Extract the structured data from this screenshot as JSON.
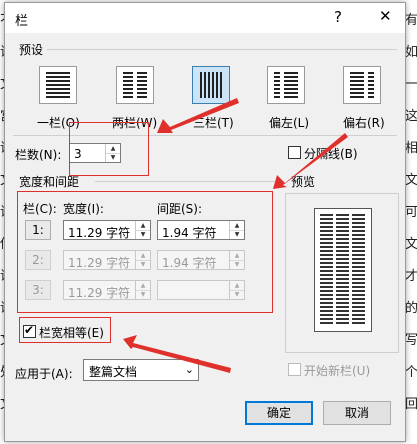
{
  "background_text": {
    "left": [
      "不",
      "诗",
      "文",
      "宫",
      "诗",
      "文",
      "诗",
      "你",
      "诗",
      "诗",
      "文",
      "处",
      "文"
    ],
    "right": [
      "有",
      "如",
      "一",
      "这",
      "相",
      "文",
      "可",
      "文",
      "才",
      "的",
      "写",
      "个",
      "回"
    ]
  },
  "dialog": {
    "title": "栏",
    "help": "?",
    "close": "✕"
  },
  "presets": {
    "group_label": "预设",
    "items": [
      {
        "label": "一栏(O)",
        "icon": "one-column-icon"
      },
      {
        "label": "两栏(W)",
        "icon": "two-columns-icon"
      },
      {
        "label": "三栏(T)",
        "icon": "three-columns-icon",
        "selected": true
      },
      {
        "label": "偏左(L)",
        "icon": "left-column-icon"
      },
      {
        "label": "偏右(R)",
        "icon": "right-column-icon"
      }
    ]
  },
  "num_columns": {
    "label": "栏数(N):",
    "value": "3"
  },
  "separator": {
    "label": "分隔线(B)",
    "checked": false
  },
  "width_spacing": {
    "group_label": "宽度和间距",
    "col_header": "栏(C):",
    "width_header": "宽度(I):",
    "spacing_header": "间距(S):",
    "rows": [
      {
        "col": "1:",
        "width": "11.29 字符",
        "spacing": "1.94 字符",
        "enabled": true
      },
      {
        "col": "2:",
        "width": "11.29 字符",
        "spacing": "1.94 字符",
        "enabled": false
      },
      {
        "col": "3:",
        "width": "11.29 字符",
        "spacing": "",
        "enabled": false
      }
    ]
  },
  "preview": {
    "label": "预览"
  },
  "equal_width": {
    "label": "栏宽相等(E)",
    "checked": true
  },
  "apply_to": {
    "label": "应用于(A):",
    "value": "整篇文档"
  },
  "new_column": {
    "label": "开始新栏(U)",
    "checked": false
  },
  "buttons": {
    "ok": "确定",
    "cancel": "取消"
  },
  "colors": {
    "annotation_red": "#e0302c",
    "selected_preset_bg": "#cce4f7"
  }
}
